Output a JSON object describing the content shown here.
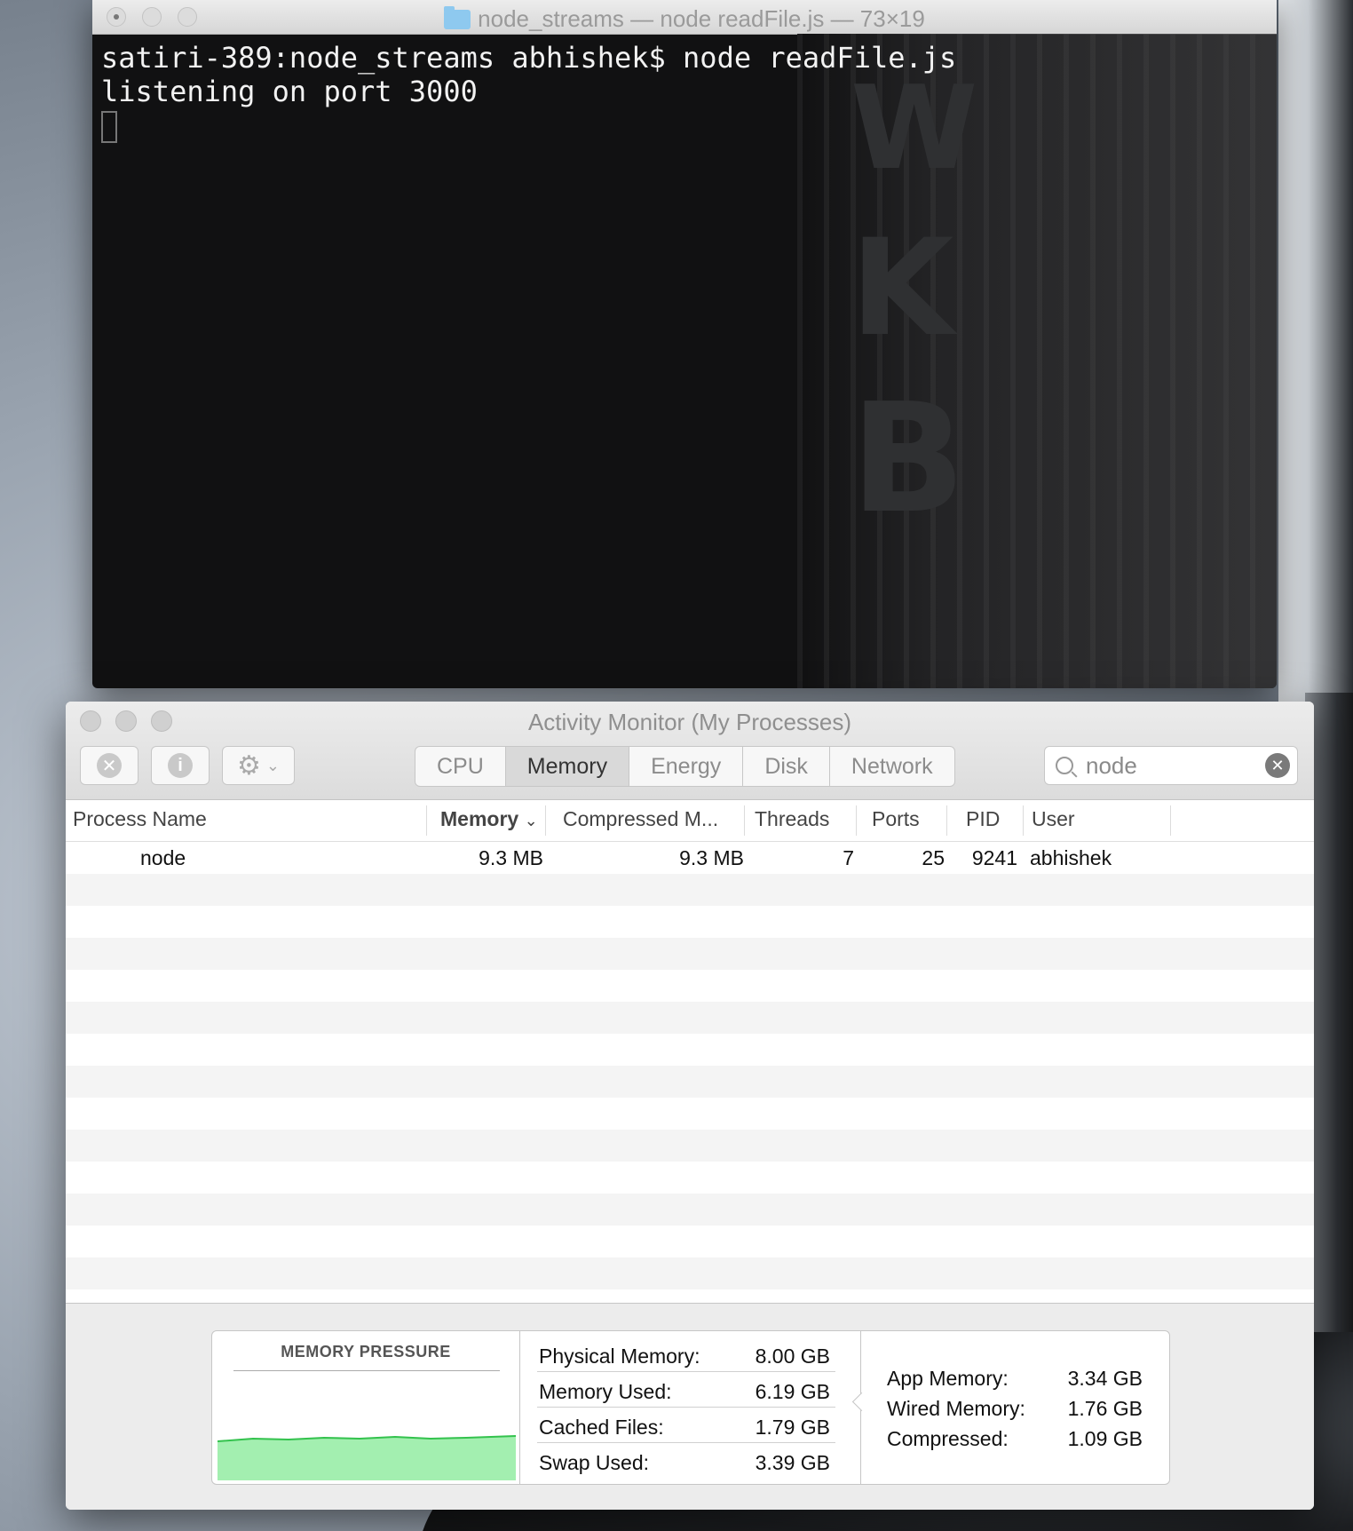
{
  "terminal": {
    "title": "node_streams — node readFile.js — 73×19",
    "lines": [
      "satiri-389:node_streams abhishek$ node readFile.js",
      "listening on port 3000"
    ]
  },
  "activity_monitor": {
    "title": "Activity Monitor (My Processes)",
    "tabs": [
      "CPU",
      "Memory",
      "Energy",
      "Disk",
      "Network"
    ],
    "active_tab": "Memory",
    "search_value": "node",
    "columns": [
      "Process Name",
      "Memory",
      "Compressed M...",
      "Threads",
      "Ports",
      "PID",
      "User"
    ],
    "rows": [
      {
        "process": "node",
        "memory": "9.3 MB",
        "compressed": "9.3 MB",
        "threads": "7",
        "ports": "25",
        "pid": "9241",
        "user": "abhishek"
      }
    ],
    "memory_pressure": {
      "title": "MEMORY PRESSURE",
      "graph_color": "#a3efb0",
      "graph_line_color": "#33c24d"
    },
    "stats_middle": [
      {
        "label": "Physical Memory:",
        "value": "8.00 GB"
      },
      {
        "label": "Memory Used:",
        "value": "6.19 GB"
      },
      {
        "label": "Cached Files:",
        "value": "1.79 GB"
      },
      {
        "label": "Swap Used:",
        "value": "3.39 GB"
      }
    ],
    "stats_right": [
      {
        "label": "App Memory:",
        "value": "3.34 GB"
      },
      {
        "label": "Wired Memory:",
        "value": "1.76 GB"
      },
      {
        "label": "Compressed:",
        "value": "1.09 GB"
      }
    ]
  }
}
